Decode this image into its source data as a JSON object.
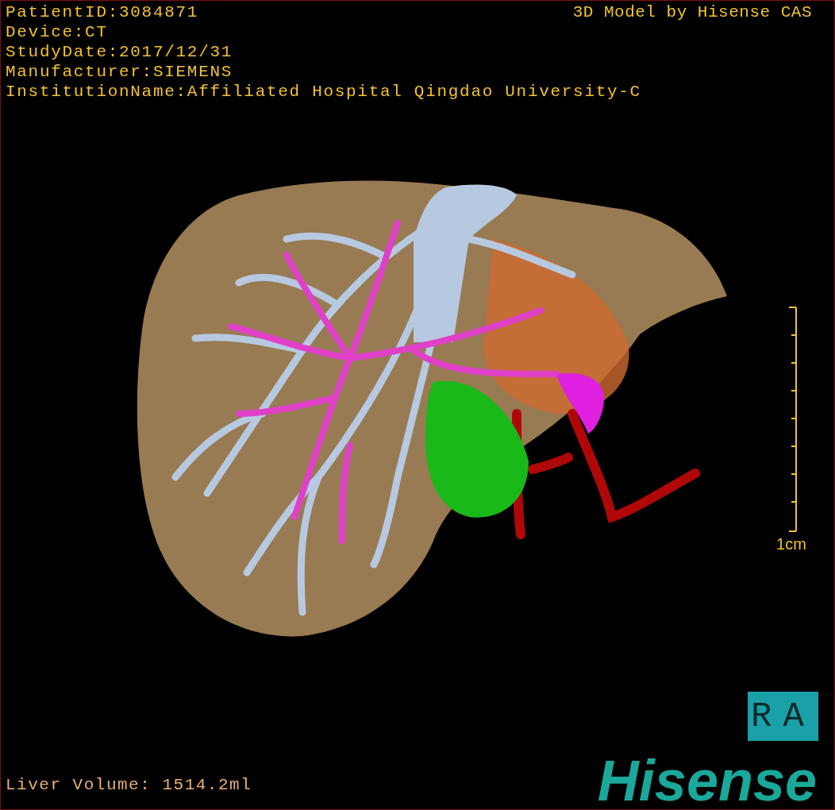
{
  "info_lines": [
    "PatientID:3084871",
    "Device:CT",
    "StudyDate:2017/12/31",
    "Manufacturer:SIEMENS",
    "InstitutionName:Affiliated Hospital Qingdao University-C"
  ],
  "title": "3D Model by Hisense CAS",
  "scale": {
    "label": "1cm"
  },
  "orientation_marker": "RA",
  "liver_volume": "Liver Volume: 1514.2ml",
  "logo": "Hisense"
}
